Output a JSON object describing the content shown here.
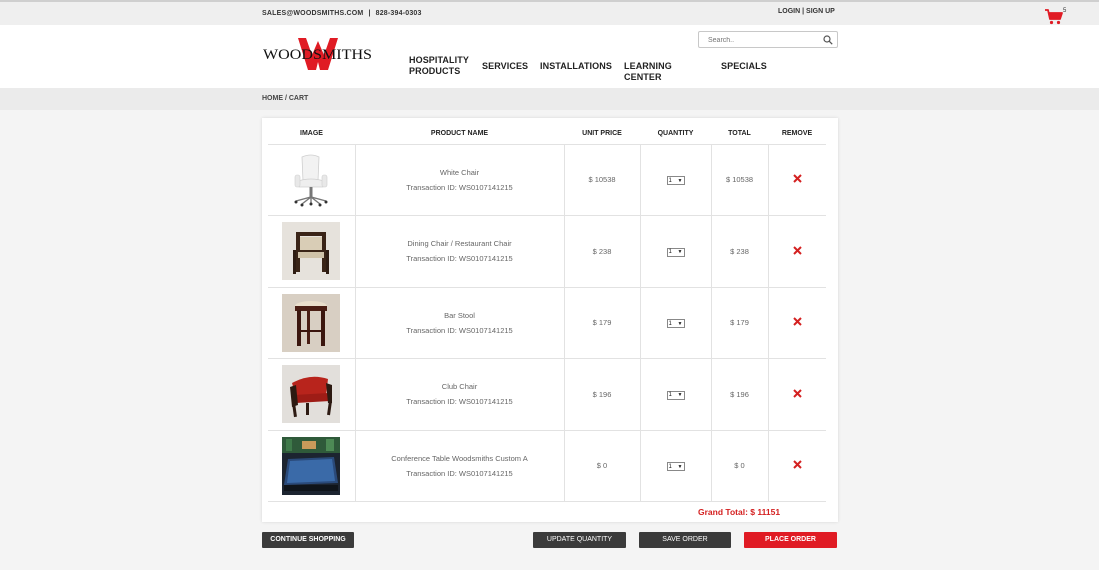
{
  "topbar": {
    "email": "SALES@WOODSMITHS.COM",
    "separator": "|",
    "phone": "828-394-0303",
    "login": "LOGIN",
    "auth_separator": "|",
    "signup": "SIGN UP",
    "cart_count": "5"
  },
  "header": {
    "logo_text": "WOODSMITHS",
    "search_placeholder": "Search..",
    "nav": {
      "hospitality_line1": "HOSPITALITY",
      "hospitality_line2": "PRODUCTS",
      "services": "SERVICES",
      "installations": "INSTALLATIONS",
      "learning_center": "LEARNING CENTER",
      "specials": "SPECIALS"
    }
  },
  "breadcrumb": "HOME / CART",
  "table": {
    "headers": {
      "image": "IMAGE",
      "product_name": "PRODUCT NAME",
      "unit_price": "UNIT PRICE",
      "quantity": "QUANTITY",
      "total": "TOTAL",
      "remove": "REMOVE"
    },
    "rows": [
      {
        "name": "White Chair",
        "transaction": "Transaction ID:  WS0107141215",
        "unit_price": "$ 10538",
        "quantity": "1",
        "total": "$ 10538",
        "thumb": "white-office-chair"
      },
      {
        "name": "Dining Chair / Restaurant Chair",
        "transaction": "Transaction ID:  WS0107141215",
        "unit_price": "$ 238",
        "quantity": "1",
        "total": "$ 238",
        "thumb": "dining-chair"
      },
      {
        "name": "Bar Stool",
        "transaction": "Transaction ID:  WS0107141215",
        "unit_price": "$ 179",
        "quantity": "1",
        "total": "$ 179",
        "thumb": "bar-stool"
      },
      {
        "name": "Club Chair",
        "transaction": "Transaction ID:  WS0107141215",
        "unit_price": "$ 196",
        "quantity": "1",
        "total": "$ 196",
        "thumb": "club-chair"
      },
      {
        "name": "Conference Table Woodsmiths Custom A",
        "transaction": "Transaction ID:  WS0107141215",
        "unit_price": "$ 0",
        "quantity": "1",
        "total": "$ 0",
        "thumb": "conference-table"
      }
    ],
    "grand_total": "Grand Total: $ 11151"
  },
  "buttons": {
    "continue_shopping": "CONTINUE SHOPPING",
    "update_quantity": "UPDATE QUANTITY",
    "save_order": "SAVE ORDER",
    "place_order": "PLACE ORDER"
  },
  "colors": {
    "accent_red": "#e01b24",
    "dark_button": "#3b3b3b",
    "remove_red": "#d42020"
  }
}
